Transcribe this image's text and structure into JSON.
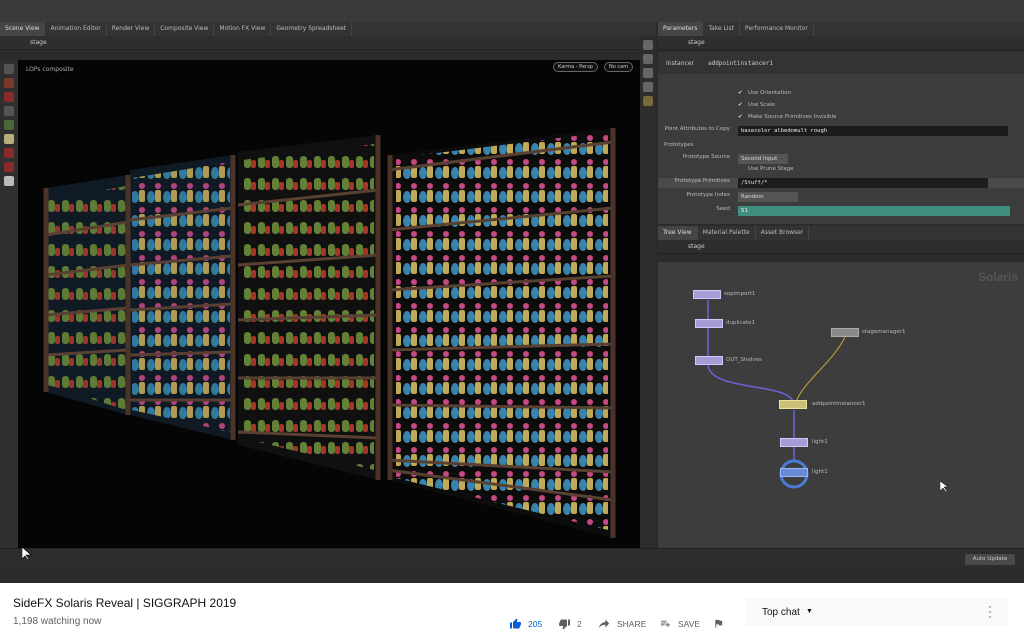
{
  "houdini": {
    "left_tabs": [
      "Scene View",
      "Animation Editor",
      "Render View",
      "Composite View",
      "Motion FX View",
      "Geometry Spreadsheet"
    ],
    "left_path": "stage",
    "viewport_label": "LOPs composite",
    "viewport_camera": "Karma - Persp",
    "viewport_display": "No cam",
    "right_top_tabs": [
      "Parameters",
      "Take List",
      "Performance Monitor"
    ],
    "right_top_path": "stage",
    "param_node_type": "Instancer",
    "param_node_name": "addpointinstancer1",
    "checkboxes": [
      "Use Orientation",
      "Use Scale",
      "Make Source Primitives Invisible"
    ],
    "attributes_label": "Point Attributes to Copy",
    "attributes_value": "basecolor albedomult rough",
    "prototypes_heading": "Prototypes",
    "prototype_source_label": "Prototype Source",
    "prototype_source_value": "Second Input",
    "use_prune_label": "Use Prune Stage",
    "prototype_primitives_label": "Prototype Primitives",
    "prototype_primitives_value": "/Stuff/*",
    "prototype_index_label": "Prototype Index",
    "prototype_index_value": "Random",
    "seed_label": "Seed",
    "seed_value": "51",
    "right_bottom_tabs": [
      "Tree View",
      "Material Palette",
      "Asset Browser"
    ],
    "right_bottom_path": "stage",
    "network_context": "Solaris",
    "nodes": [
      {
        "label": "sopimport1"
      },
      {
        "label": "duplicate1"
      },
      {
        "label": "OUT_Shelves"
      },
      {
        "label": "stagemanager1"
      },
      {
        "label": "addpointinstancer1"
      },
      {
        "label": "light1"
      },
      {
        "label": "light1"
      }
    ],
    "status_button": "Auto Update"
  },
  "youtube": {
    "title": "SideFX Solaris Reveal | SIGGRAPH 2019",
    "watching": "1,198 watching now",
    "likes": "205",
    "dislikes": "2",
    "share_label": "SHARE",
    "save_label": "SAVE",
    "top_chat_label": "Top chat",
    "accent": "#065fd4"
  }
}
